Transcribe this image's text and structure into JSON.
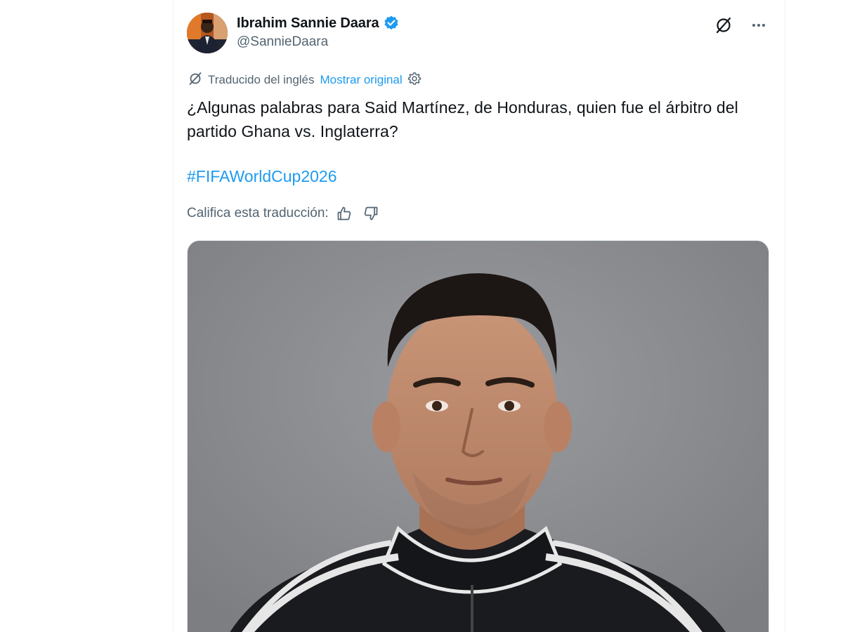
{
  "author": {
    "name": "Ibrahim Sannie Daara",
    "handle": "@SannieDaara",
    "verified": true
  },
  "header_icons": [
    "grok-translate-icon",
    "more-options-icon"
  ],
  "translation": {
    "label": "Traducido del inglés",
    "show_original": "Mostrar original"
  },
  "tweet": {
    "text": "¿Algunas palabras para Said Martínez, de Honduras, quien fue el árbitro del partido Ghana vs. Inglaterra?",
    "hashtag": "#FIFAWorldCup2026"
  },
  "rating": {
    "label": "Califica esta traducción:"
  },
  "colors": {
    "accent": "#1d9bf0",
    "text_primary": "#0f1419",
    "text_secondary": "#536471",
    "media_background": "#8a8b8f"
  }
}
